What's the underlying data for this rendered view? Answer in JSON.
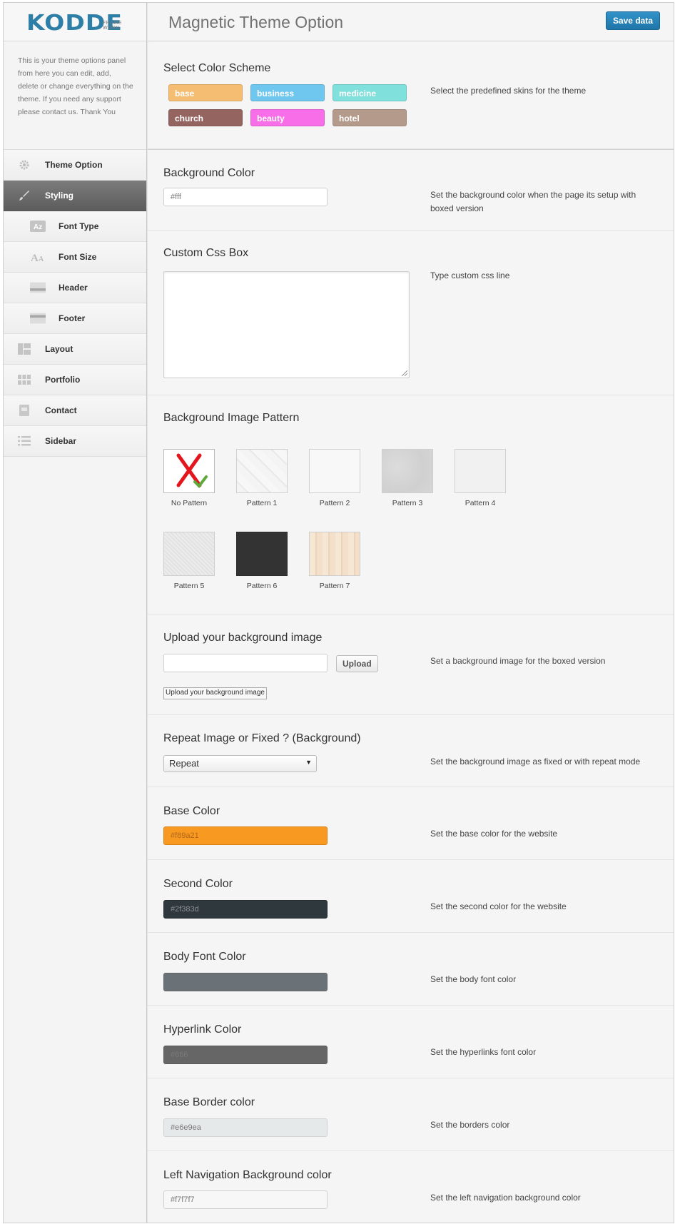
{
  "app": {
    "logo": "KODDE",
    "logo_sub": "FRAME WORK",
    "page_title": "Magnetic Theme Option",
    "save_label": "Save data"
  },
  "sidebar": {
    "intro": "This is your theme options panel from here you can edit, add, delete or change everything on the theme. If you need any support please contact us. Thank You",
    "items": [
      {
        "label": "Theme Option",
        "icon": "gear-icon",
        "sub": false,
        "active": false
      },
      {
        "label": "Styling",
        "icon": "brush-icon",
        "sub": false,
        "active": true
      },
      {
        "label": "Font Type",
        "icon": "font-type-icon",
        "sub": true,
        "active": false
      },
      {
        "label": "Font Size",
        "icon": "font-size-icon",
        "sub": true,
        "active": false
      },
      {
        "label": "Header",
        "icon": "header-icon",
        "sub": true,
        "active": false
      },
      {
        "label": "Footer",
        "icon": "footer-icon",
        "sub": true,
        "active": false
      },
      {
        "label": "Layout",
        "icon": "layout-icon",
        "sub": false,
        "active": false
      },
      {
        "label": "Portfolio",
        "icon": "grid-icon",
        "sub": false,
        "active": false
      },
      {
        "label": "Contact",
        "icon": "contact-icon",
        "sub": false,
        "active": false
      },
      {
        "label": "Sidebar",
        "icon": "list-icon",
        "sub": false,
        "active": false
      }
    ]
  },
  "color_scheme": {
    "title": "Select Color Scheme",
    "desc": "Select the predefined skins for the theme",
    "skins": [
      {
        "label": "base",
        "color": "#f5bd72"
      },
      {
        "label": "business",
        "color": "#6fc6ee"
      },
      {
        "label": "medicine",
        "color": "#7fe0dc"
      },
      {
        "label": "church",
        "color": "#946460"
      },
      {
        "label": "beauty",
        "color": "#f76ee8"
      },
      {
        "label": "hotel",
        "color": "#b49a8a"
      }
    ]
  },
  "background_color": {
    "title": "Background Color",
    "value": "#fff",
    "desc": "Set the background color when the page its setup with boxed version"
  },
  "custom_css": {
    "title": "Custom Css Box",
    "desc": "Type custom css line"
  },
  "patterns": {
    "title": "Background Image Pattern",
    "items": [
      {
        "label": "No Pattern"
      },
      {
        "label": "Pattern 1"
      },
      {
        "label": "Pattern 2"
      },
      {
        "label": "Pattern 3"
      },
      {
        "label": "Pattern 4"
      },
      {
        "label": "Pattern 5"
      },
      {
        "label": "Pattern 6"
      },
      {
        "label": "Pattern 7"
      }
    ]
  },
  "upload": {
    "title": "Upload your background image",
    "button": "Upload",
    "preview_text": "Upload your background image",
    "desc": "Set a background image for the boxed version"
  },
  "repeat": {
    "title": "Repeat Image or Fixed ? (Background)",
    "selected": "Repeat",
    "desc": "Set the background image as fixed or with repeat mode"
  },
  "colors": [
    {
      "title": "Base Color",
      "value": "#f89a21",
      "bg": "#f89a21",
      "text_color": "#b0661b",
      "desc": "Set the base color for the website"
    },
    {
      "title": "Second Color",
      "value": "#2f383d",
      "bg": "#2f383d",
      "text_color": "#8a8f92",
      "desc": "Set the second color for the website"
    },
    {
      "title": "Body Font Color",
      "value": "",
      "bg": "#6b7277",
      "text_color": "#6b7277",
      "desc": "Set the body font color"
    },
    {
      "title": "Hyperlink Color",
      "value": "#666",
      "bg": "#666666",
      "text_color": "#7a7a7a",
      "desc": "Set the hyperlinks font color"
    },
    {
      "title": "Base Border color",
      "value": "#e6e9ea",
      "bg": "#e6e9ea",
      "text_color": "#777",
      "desc": "Set the borders color"
    },
    {
      "title": "Left Navigation Background color",
      "value": "#f7f7f7",
      "bg": "#f7f7f7",
      "text_color": "#777",
      "desc": "Set the left navigation background color"
    }
  ]
}
